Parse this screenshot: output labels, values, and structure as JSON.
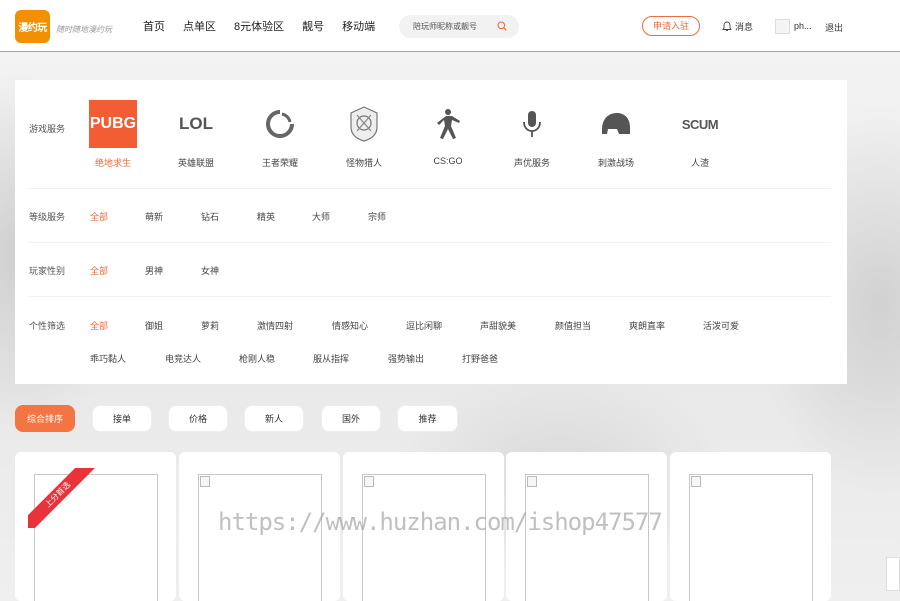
{
  "header": {
    "logo_text": "漫约玩",
    "slogan": "随时随地漫约玩",
    "nav": [
      "首页",
      "点单区",
      "8元体验区",
      "靓号",
      "移动端"
    ],
    "search_placeholder": "陪玩师昵称或靓号",
    "apply_label": "申请入驻",
    "message_label": "消息",
    "username": "ph...",
    "logout_label": "退出"
  },
  "filters": {
    "game_label": "游戏服务",
    "games": [
      {
        "name": "绝地求生",
        "icon": "pubg-icon",
        "logo_text": "PUBG",
        "active": true
      },
      {
        "name": "英雄联盟",
        "icon": "lol-icon",
        "logo_text": "LOL",
        "active": false
      },
      {
        "name": "王者荣耀",
        "icon": "honor-of-kings-icon",
        "active": false
      },
      {
        "name": "怪物猎人",
        "icon": "monster-hunter-icon",
        "active": false
      },
      {
        "name": "CS:GO",
        "icon": "csgo-icon",
        "active": false
      },
      {
        "name": "声优服务",
        "icon": "microphone-icon",
        "active": false
      },
      {
        "name": "刺激战场",
        "icon": "helmet-icon",
        "active": false
      },
      {
        "name": "人渣",
        "icon": "scum-icon",
        "logo_text": "SCUM",
        "active": false
      }
    ],
    "level_label": "等级服务",
    "levels": [
      "全部",
      "萌新",
      "钻石",
      "精英",
      "大师",
      "宗师"
    ],
    "gender_label": "玩家性别",
    "genders": [
      "全部",
      "男神",
      "女神"
    ],
    "personality_label": "个性筛选",
    "personality_row1": [
      "全部",
      "御姐",
      "萝莉",
      "激情四射",
      "情感知心",
      "逗比闲聊",
      "声甜貌美",
      "颜值担当",
      "爽朗直率",
      "活泼可爱"
    ],
    "personality_row2": [
      "乖巧黏人",
      "电竞达人",
      "枪刚人稳",
      "服从指挥",
      "强势输出",
      "打野爸爸"
    ]
  },
  "sort_tabs": [
    "综合排序",
    "接单",
    "价格",
    "新人",
    "国外",
    "推荐"
  ],
  "cards": {
    "ribbon_text": "上分首选",
    "count": 5
  },
  "watermark": "https://www.huzhan.com/ishop47577",
  "colors": {
    "accent": "#f06a3c",
    "logo": "#f39000",
    "ribbon": "#e8333b"
  }
}
